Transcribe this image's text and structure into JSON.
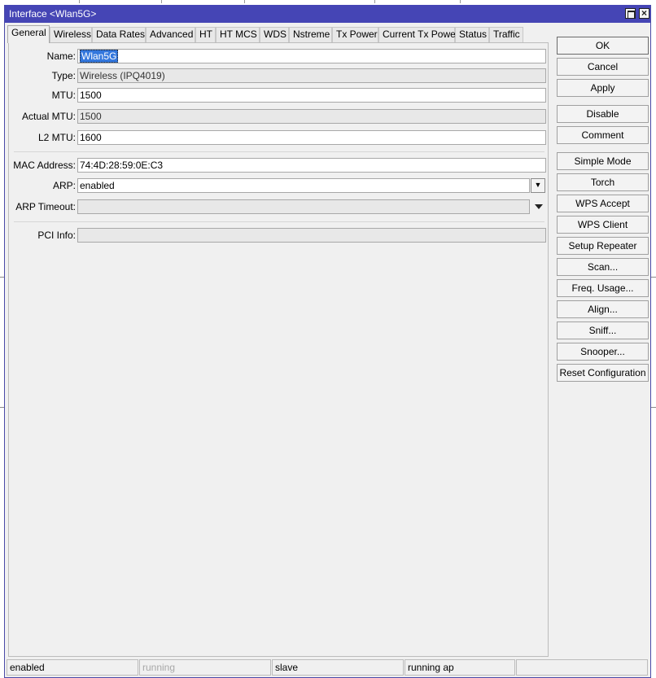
{
  "window": {
    "title": "Interface <Wlan5G>"
  },
  "tabs": [
    "General",
    "Wireless",
    "Data Rates",
    "Advanced",
    "HT",
    "HT MCS",
    "WDS",
    "Nstreme",
    "Tx Power",
    "Current Tx Power",
    "Status",
    "Traffic"
  ],
  "form": {
    "name_label": "Name:",
    "name_value": "Wlan5G",
    "type_label": "Type:",
    "type_value": "Wireless (IPQ4019)",
    "mtu_label": "MTU:",
    "mtu_value": "1500",
    "actual_mtu_label": "Actual MTU:",
    "actual_mtu_value": "1500",
    "l2_mtu_label": "L2 MTU:",
    "l2_mtu_value": "1600",
    "mac_label": "MAC Address:",
    "mac_value": "74:4D:28:59:0E:C3",
    "arp_label": "ARP:",
    "arp_value": "enabled",
    "arp_timeout_label": "ARP Timeout:",
    "arp_timeout_value": "",
    "pci_label": "PCI Info:",
    "pci_value": ""
  },
  "buttons": [
    "OK",
    "Cancel",
    "Apply",
    "Disable",
    "Comment",
    "Simple Mode",
    "Torch",
    "WPS Accept",
    "WPS Client",
    "Setup Repeater",
    "Scan...",
    "Freq. Usage...",
    "Align...",
    "Sniff...",
    "Snooper...",
    "Reset Configuration"
  ],
  "status_bar": {
    "state": "enabled",
    "running": "running",
    "mode": "slave",
    "ap_status": "running ap"
  },
  "colors": {
    "titlebar": "#4545b5",
    "selection": "#3377dd"
  }
}
